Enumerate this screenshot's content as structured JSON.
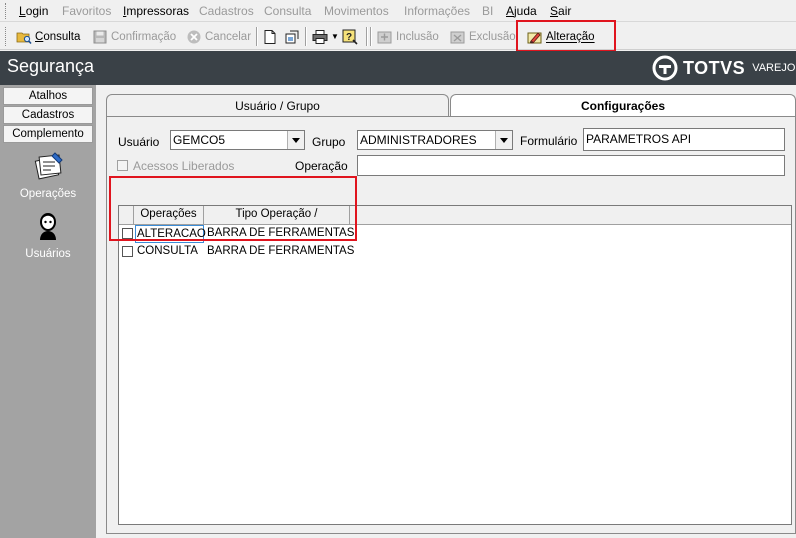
{
  "menubar": {
    "items": [
      {
        "label": "Login",
        "enabled": true
      },
      {
        "label": "Favoritos",
        "enabled": false
      },
      {
        "label": "Impressoras",
        "enabled": true
      },
      {
        "label": "Cadastros",
        "enabled": false
      },
      {
        "label": "Consulta",
        "enabled": false
      },
      {
        "label": "Movimentos",
        "enabled": false
      },
      {
        "label": "Informações",
        "enabled": false
      },
      {
        "label": "BI",
        "enabled": false
      },
      {
        "label": "Ajuda",
        "enabled": true
      },
      {
        "label": "Sair",
        "enabled": true
      }
    ]
  },
  "toolbar": {
    "consulta_label": "Consulta",
    "confirmacao_label": "Confirmação",
    "cancelar_label": "Cancelar",
    "inclusao_label": "Inclusão",
    "exclusao_label": "Exclusão",
    "alteracao_label": "Alteração"
  },
  "header": {
    "title": "Segurança",
    "brand": "TOTVS",
    "brand_sub": "VAREJO"
  },
  "left_panel": {
    "tabs": [
      "Atalhos",
      "Cadastros",
      "Complemento"
    ],
    "items": [
      {
        "label": "Operações",
        "icon": "operations-icon"
      },
      {
        "label": "Usuários",
        "icon": "user-icon"
      }
    ]
  },
  "main": {
    "tabs": [
      {
        "label": "Usuário  / Grupo",
        "active": false
      },
      {
        "label": "Configurações",
        "active": true
      }
    ],
    "form": {
      "usuario_label": "Usuário",
      "usuario_value": "GEMCO5",
      "grupo_label": "Grupo",
      "grupo_value": "ADMINISTRADORES",
      "formulario_label": "Formulário",
      "formulario_value": "PARAMETROS API",
      "acessos_liberados_label": "Acessos Liberados",
      "operacao_label": "Operação",
      "operacao_value": ""
    },
    "grid": {
      "columns": [
        "Operações",
        "Tipo Operação  /"
      ],
      "rows": [
        {
          "operacao": "ALTERACAO",
          "tipo": "BARRA DE FERRAMENTAS",
          "checked": false
        },
        {
          "operacao": "CONSULTA",
          "tipo": "BARRA DE FERRAMENTAS",
          "checked": false
        }
      ]
    }
  },
  "colors": {
    "header_bg": "#3a4147",
    "left_panel_bg": "#a3a3a3",
    "highlight_red": "#e0141e",
    "disabled_text": "#9a9a9a"
  }
}
